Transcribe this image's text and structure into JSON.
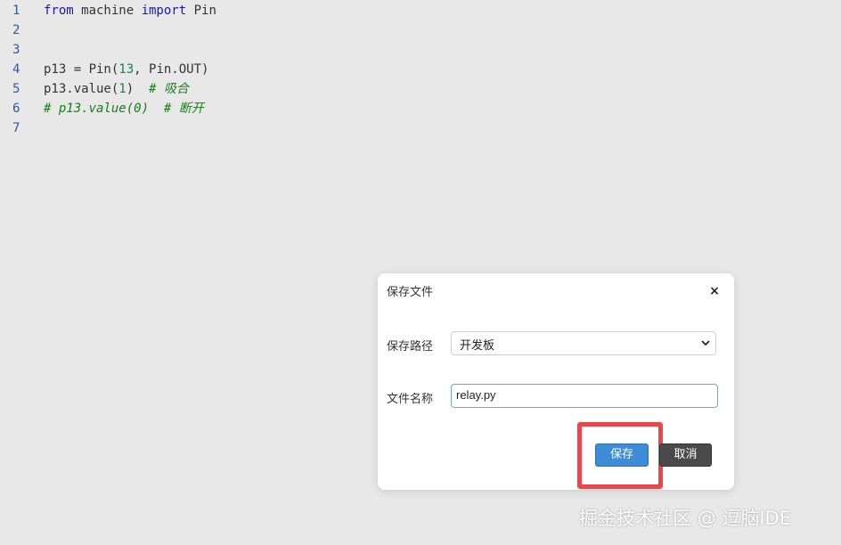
{
  "editor": {
    "lines": [
      {
        "num": "1",
        "parts": [
          {
            "t": "from",
            "c": "kw"
          },
          {
            "t": " machine ",
            "c": ""
          },
          {
            "t": "import",
            "c": "kw"
          },
          {
            "t": " Pin",
            "c": ""
          }
        ]
      },
      {
        "num": "2",
        "parts": []
      },
      {
        "num": "3",
        "parts": []
      },
      {
        "num": "4",
        "parts": [
          {
            "t": "p13 = Pin(",
            "c": ""
          },
          {
            "t": "13",
            "c": "num"
          },
          {
            "t": ", Pin.OUT)",
            "c": ""
          }
        ]
      },
      {
        "num": "5",
        "parts": [
          {
            "t": "p13.value(",
            "c": ""
          },
          {
            "t": "1",
            "c": "num"
          },
          {
            "t": ")  ",
            "c": ""
          },
          {
            "t": "# 吸合",
            "c": "cm"
          }
        ]
      },
      {
        "num": "6",
        "parts": [
          {
            "t": "# p13.value(0)  # 断开",
            "c": "cm"
          }
        ]
      },
      {
        "num": "7",
        "parts": []
      }
    ]
  },
  "dialog": {
    "title": "保存文件",
    "close_label": "×",
    "path_label": "保存路径",
    "path_value": "开发板",
    "name_label": "文件名称",
    "name_value": "relay.py",
    "save_label": "保存",
    "cancel_label": "取消"
  },
  "watermark": "掘金技术社区 @ 逗脑IDE",
  "colors": {
    "editor_bg": "#e8e8e8",
    "save_button": "#3e8bd6",
    "cancel_button": "#4a4a4a",
    "highlight": "#e8474f"
  },
  "icons": {
    "close": "close-icon",
    "dropdown": "chevron-down-icon"
  }
}
